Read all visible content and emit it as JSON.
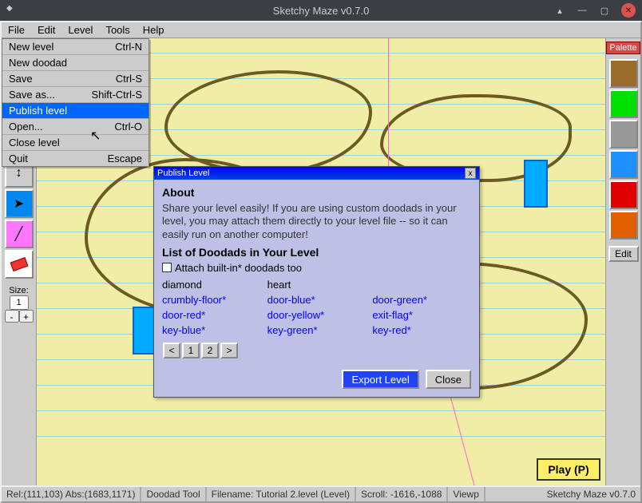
{
  "window": {
    "title": "Sketchy Maze v0.7.0"
  },
  "menubar": {
    "file": "File",
    "edit": "Edit",
    "level": "Level",
    "tools": "Tools",
    "help": "Help"
  },
  "filemenu": {
    "items": [
      {
        "label": "New level",
        "accel": "Ctrl-N"
      },
      {
        "label": "New doodad",
        "accel": ""
      },
      {
        "label": "Save",
        "accel": "Ctrl-S"
      },
      {
        "label": "Save as...",
        "accel": "Shift-Ctrl-S"
      },
      {
        "label": "Publish level",
        "accel": ""
      },
      {
        "label": "Open...",
        "accel": "Ctrl-O"
      },
      {
        "label": "Close level",
        "accel": ""
      },
      {
        "label": "Quit",
        "accel": "Escape"
      }
    ],
    "highlight_index": 4
  },
  "toolbar": {
    "size_label": "Size:",
    "size_value": "1",
    "minus": "-",
    "plus": "+"
  },
  "palette": {
    "header": "Palette",
    "swatches": [
      "#9b6b2b",
      "#00e000",
      "#999999",
      "#1e90ff",
      "#e00000",
      "#e06000"
    ],
    "edit": "Edit"
  },
  "dialog": {
    "title": "Publish Level",
    "about_heading": "About",
    "about_text": "Share your level easily! If you are using custom doodads in your level, you may attach them directly to your level file -- so it can easily run on another computer!",
    "list_heading": "List of Doodads in Your Level",
    "attach_label": "Attach built-in* doodads too",
    "doodads": [
      {
        "name": "diamond",
        "builtin": false
      },
      {
        "name": "heart",
        "builtin": false
      },
      {
        "name": "",
        "builtin": false
      },
      {
        "name": "crumbly-floor*",
        "builtin": true
      },
      {
        "name": "door-blue*",
        "builtin": true
      },
      {
        "name": "door-green*",
        "builtin": true
      },
      {
        "name": "door-red*",
        "builtin": true
      },
      {
        "name": "door-yellow*",
        "builtin": true
      },
      {
        "name": "exit-flag*",
        "builtin": true
      },
      {
        "name": "key-blue*",
        "builtin": true
      },
      {
        "name": "key-green*",
        "builtin": true
      },
      {
        "name": "key-red*",
        "builtin": true
      }
    ],
    "pager": {
      "prev": "<",
      "p1": "1",
      "p2": "2",
      "next": ">"
    },
    "export": "Export Level",
    "close": "Close"
  },
  "play_button": "Play  (P)",
  "statusbar": {
    "coords": "Rel:(111,103)   Abs:(1683,1171)",
    "tool": "Doodad Tool",
    "filename": "Filename: Tutorial 2.level (Level)",
    "scroll": "Scroll: -1616,-1088",
    "viewport": "Viewp",
    "version": "Sketchy Maze v0.7.0"
  }
}
